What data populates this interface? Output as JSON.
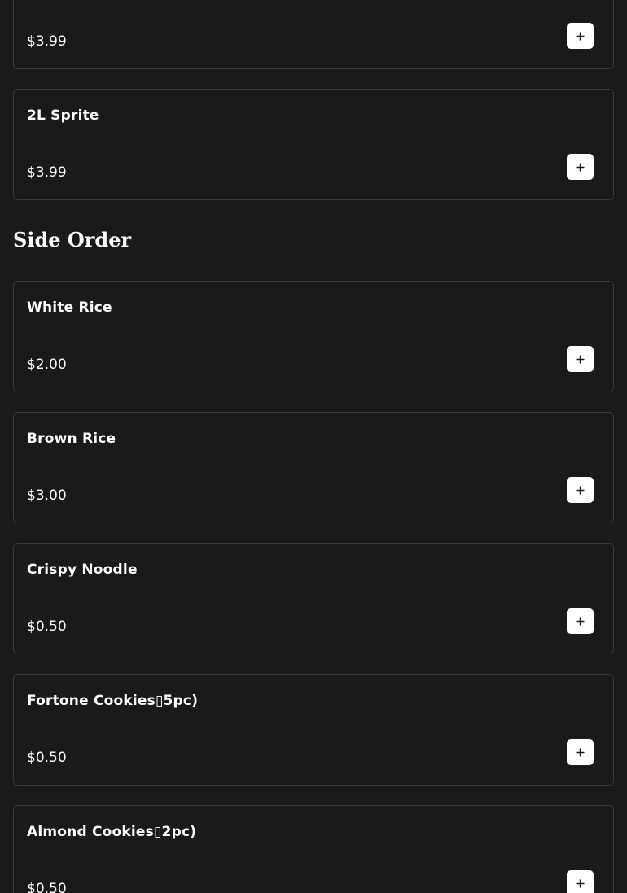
{
  "drinks": {
    "items": [
      {
        "name": "",
        "price": "$3.99"
      },
      {
        "name": "2L Sprite",
        "price": "$3.99"
      }
    ]
  },
  "side_order": {
    "title": "Side Order",
    "items": [
      {
        "name": "White Rice",
        "price": "$2.00"
      },
      {
        "name": "Brown Rice",
        "price": "$3.00"
      },
      {
        "name": "Crispy Noodle",
        "price": "$0.50"
      },
      {
        "name": "Fortone Cookies▯5pc)",
        "price": "$0.50"
      },
      {
        "name": "Almond Cookies▯2pc)",
        "price": "$0.50"
      }
    ]
  },
  "icons": {
    "add": "plus-icon"
  },
  "colors": {
    "background": "#1a1a1a",
    "card_border": "#3a3a3a",
    "button_bg": "#ffffff",
    "text": "#ffffff"
  }
}
